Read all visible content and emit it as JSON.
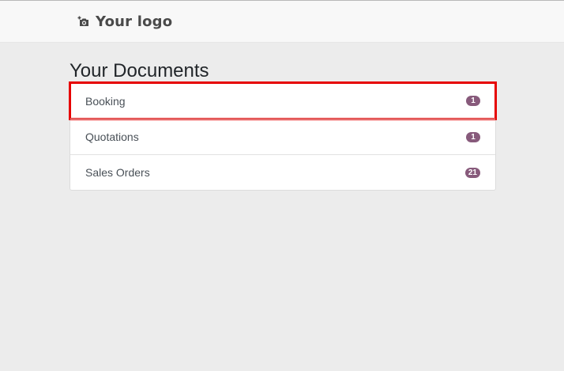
{
  "header": {
    "logo_text": "Your logo",
    "logo_icon": "camera-icon"
  },
  "main": {
    "title": "Your Documents",
    "documents": [
      {
        "label": "Booking",
        "count": "1",
        "highlighted": true
      },
      {
        "label": "Quotations",
        "count": "1",
        "highlighted": false
      },
      {
        "label": "Sales Orders",
        "count": "21",
        "highlighted": false
      }
    ]
  },
  "colors": {
    "badge": "#875a7b",
    "highlight": "#e60000",
    "background": "#ececec"
  }
}
